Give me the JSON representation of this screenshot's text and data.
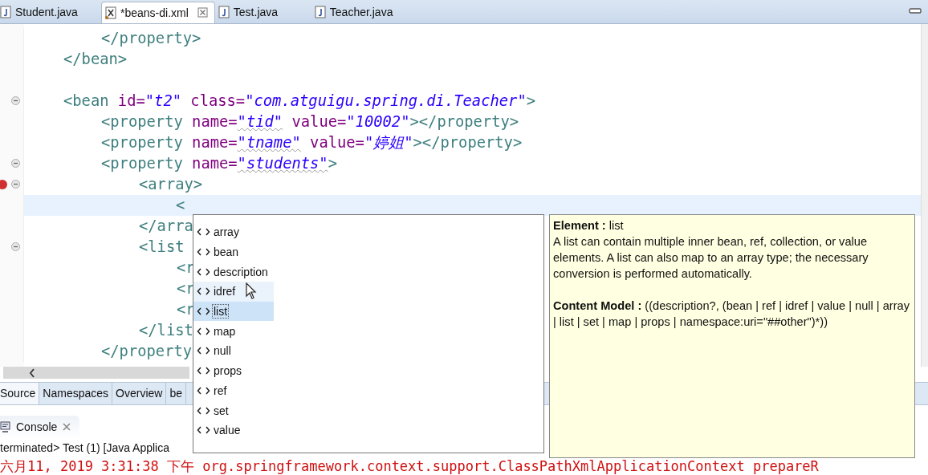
{
  "editor_tabs": [
    {
      "label": "Student.java",
      "kind": "java",
      "selected": false,
      "closable": false
    },
    {
      "label": "*beans-di.xml",
      "kind": "xml",
      "selected": true,
      "closable": true
    },
    {
      "label": "Test.java",
      "kind": "java",
      "selected": false,
      "closable": false
    },
    {
      "label": "Teacher.java",
      "kind": "java",
      "selected": false,
      "closable": false
    }
  ],
  "code_lines": [
    {
      "kind": "group",
      "children": [
        {
          "kind": "line",
          "fold": false,
          "error": false,
          "current": false,
          "tokens": [
            {
              "kind": "tag",
              "text": "</property>"
            }
          ]
        }
      ]
    },
    {
      "kind": "line",
      "fold": false,
      "error": false,
      "current": false,
      "tokens": [
        {
          "kind": "tag",
          "text": "</bean>"
        }
      ]
    },
    {
      "kind": "blank"
    },
    {
      "kind": "line",
      "fold": true,
      "error": false,
      "current": false,
      "tokens": [
        {
          "kind": "tag",
          "text": "<bean"
        },
        {
          "kind": "attr",
          "text": " id="
        },
        {
          "kind": "value",
          "text": "\"t2\"",
          "squiggle": false
        },
        {
          "kind": "attr",
          "text": " class="
        },
        {
          "kind": "value",
          "text": "\"com.atguigu.spring.di.Teacher\"",
          "squiggle": false
        },
        {
          "kind": "tag",
          "text": ">"
        }
      ],
      "children": [
        {
          "kind": "line",
          "fold": false,
          "error": false,
          "current": false,
          "tokens": [
            {
              "kind": "tag",
              "text": "<property"
            },
            {
              "kind": "attr",
              "text": " name="
            },
            {
              "kind": "value",
              "text": "\"tid\"",
              "squiggle": true
            },
            {
              "kind": "attr",
              "text": " value="
            },
            {
              "kind": "value",
              "text": "\"10002\"",
              "squiggle": false
            },
            {
              "kind": "tag",
              "text": "></property>"
            }
          ]
        },
        {
          "kind": "line",
          "fold": false,
          "error": false,
          "current": false,
          "tokens": [
            {
              "kind": "tag",
              "text": "<property"
            },
            {
              "kind": "attr",
              "text": " name="
            },
            {
              "kind": "value",
              "text": "\"tname\"",
              "squiggle": true
            },
            {
              "kind": "attr",
              "text": " value="
            },
            {
              "kind": "value",
              "text": "\"婷姐\"",
              "squiggle": false
            },
            {
              "kind": "tag",
              "text": "></property>"
            }
          ]
        },
        {
          "kind": "line",
          "fold": true,
          "error": false,
          "current": false,
          "tokens": [
            {
              "kind": "tag",
              "text": "<property"
            },
            {
              "kind": "attr",
              "text": " name="
            },
            {
              "kind": "value",
              "text": "\"students\"",
              "squiggle": true
            },
            {
              "kind": "tag",
              "text": ">"
            }
          ],
          "children": [
            {
              "kind": "line",
              "fold": true,
              "error": true,
              "current": false,
              "tokens": [
                {
                  "kind": "tag",
                  "text": "<array>"
                }
              ],
              "children": [
                {
                  "kind": "line",
                  "fold": false,
                  "error": false,
                  "current": true,
                  "tokens": [
                    {
                      "kind": "tag",
                      "text": "<"
                    }
                  ]
                }
              ]
            },
            {
              "kind": "line",
              "fold": false,
              "error": false,
              "current": false,
              "tokens": [
                {
                  "kind": "tag",
                  "text": "</arra"
                }
              ]
            },
            {
              "kind": "line",
              "fold": true,
              "error": false,
              "current": false,
              "tokens": [
                {
                  "kind": "tag",
                  "text": "<list"
                }
              ],
              "children": [
                {
                  "kind": "line",
                  "fold": false,
                  "error": false,
                  "current": false,
                  "tokens": [
                    {
                      "kind": "tag",
                      "text": "<r"
                    }
                  ]
                },
                {
                  "kind": "line",
                  "fold": false,
                  "error": false,
                  "current": false,
                  "tokens": [
                    {
                      "kind": "tag",
                      "text": "<r"
                    }
                  ]
                },
                {
                  "kind": "line",
                  "fold": false,
                  "error": false,
                  "current": false,
                  "tokens": [
                    {
                      "kind": "tag",
                      "text": "<r"
                    }
                  ]
                }
              ]
            },
            {
              "kind": "line",
              "fold": false,
              "error": false,
              "current": false,
              "tokens": [
                {
                  "kind": "tag",
                  "text": "</list"
                }
              ]
            }
          ]
        },
        {
          "kind": "line",
          "fold": false,
          "error": false,
          "current": false,
          "tokens": [
            {
              "kind": "tag",
              "text": "</property"
            }
          ]
        }
      ]
    }
  ],
  "completion_items": [
    {
      "label": "array",
      "selected": false,
      "hovered": false
    },
    {
      "label": "bean",
      "selected": false,
      "hovered": false
    },
    {
      "label": "description",
      "selected": false,
      "hovered": false
    },
    {
      "label": "idref",
      "selected": false,
      "hovered": true
    },
    {
      "label": "list",
      "selected": true,
      "hovered": false
    },
    {
      "label": "map",
      "selected": false,
      "hovered": false
    },
    {
      "label": "null",
      "selected": false,
      "hovered": false
    },
    {
      "label": "props",
      "selected": false,
      "hovered": false
    },
    {
      "label": "ref",
      "selected": false,
      "hovered": false
    },
    {
      "label": "set",
      "selected": false,
      "hovered": false
    },
    {
      "label": "value",
      "selected": false,
      "hovered": false
    }
  ],
  "info": {
    "heading": "**Element :** list",
    "description": "A list can contain multiple inner bean, ref, collection, or value elements. A list can also map to an array type; the necessary conversion is performed automatically.",
    "content_model": "**Content Model :** ((description?, (bean | ref | idref | value | null | array | list | set | map | props | namespace:uri=\"##other\")*))"
  },
  "bottom_tabs": [
    {
      "label": "Source",
      "selected": true
    },
    {
      "label": "Namespaces",
      "selected": false
    },
    {
      "label": "Overview",
      "selected": false
    },
    {
      "label": "be",
      "selected": false
    }
  ],
  "console": {
    "title": "Console",
    "status": "terminated> Test (1) [Java Applica",
    "log": "六月11, 2019 3:31:38 下午 org.springframework.context.support.ClassPathXmlApplicationContext prepareR"
  }
}
